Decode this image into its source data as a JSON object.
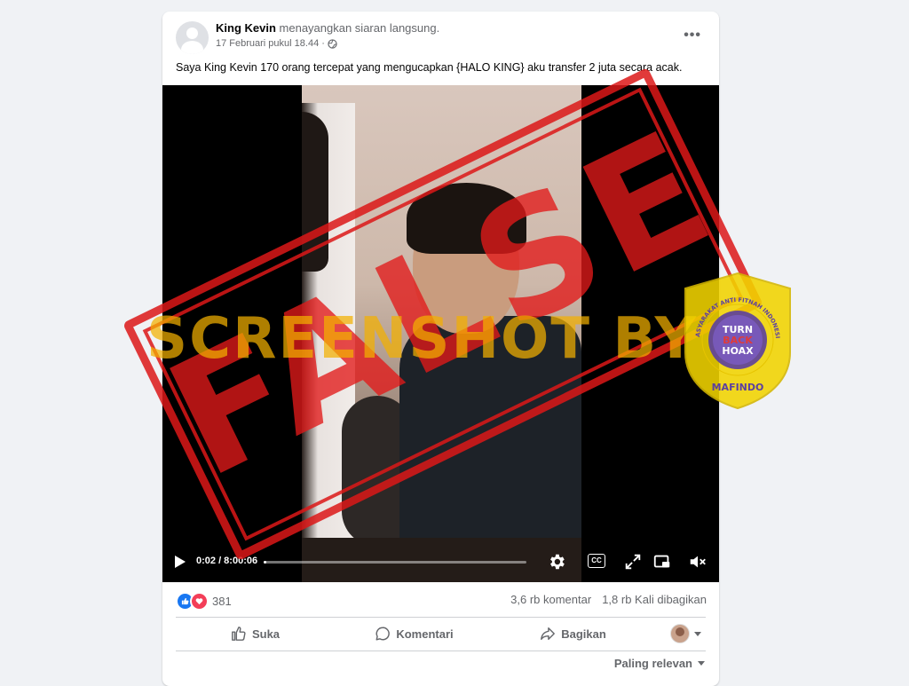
{
  "post": {
    "author": "King Kevin",
    "action": "menayangkan siaran langsung.",
    "timestamp": "17 Februari pukul 18.44",
    "separator": "·",
    "more_glyph": "•••",
    "caption": "Saya King Kevin 170 orang tercepat yang mengucapkan {HALO KING} aku transfer 2 juta secara acak."
  },
  "video": {
    "current_time": "0:02",
    "duration": "8:00:06",
    "time_display": "0:02 / 8:00:06",
    "progress": 0.01,
    "cc_label": "CC"
  },
  "overlay": {
    "stamp_text": "FALSE",
    "watermark_text": "SCREENSHOT BY",
    "badge_top": "MASYARAKAT ANTI FITNAH INDONESIA",
    "badge_bottom": "MAFINDO",
    "badge_logo_lines": [
      "TURN",
      "BACK",
      "HOAX"
    ],
    "colors": {
      "stamp": "#e01919",
      "watermark": "#f3b000",
      "badge": "#f2d400",
      "badge_inner": "#5b3fa0"
    }
  },
  "engagement": {
    "reaction_count": "381",
    "comments": "3,6 rb komentar",
    "shares": "1,8 rb Kali dibagikan"
  },
  "actions": {
    "like": "Suka",
    "comment": "Komentari",
    "share": "Bagikan"
  },
  "sort": {
    "label": "Paling relevan"
  }
}
